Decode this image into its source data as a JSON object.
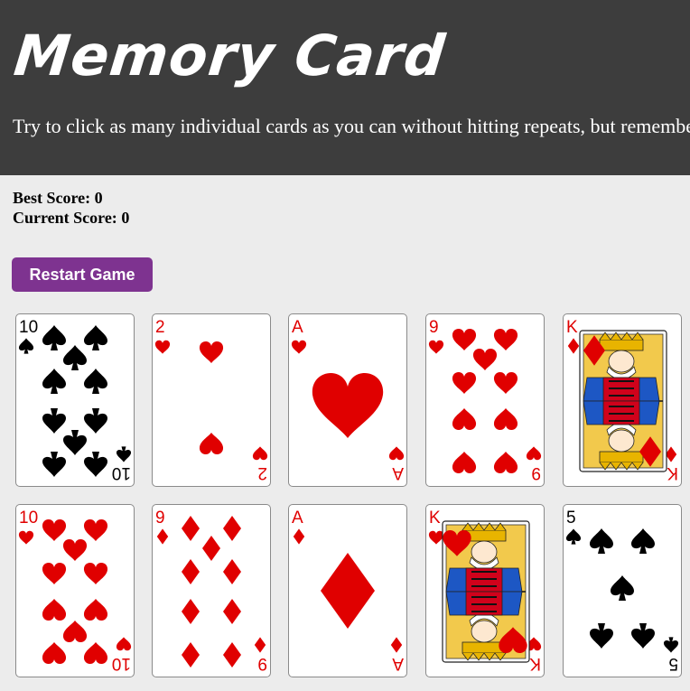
{
  "header": {
    "title": "Memory Card",
    "subtitle": "Try to click as many individual cards as you can without hitting repeats, but remember they shuffle!"
  },
  "scores": {
    "best_label": "Best Score:",
    "best_value": "0",
    "current_label": "Current Score:",
    "current_value": "0"
  },
  "controls": {
    "restart_label": "Restart Game"
  },
  "colors": {
    "header_bg": "#3d3d3d",
    "button_bg": "#7e3390",
    "red_suit": "#e00000",
    "black_suit": "#000000"
  },
  "cards": [
    {
      "rank": "10",
      "suit": "spades"
    },
    {
      "rank": "2",
      "suit": "hearts"
    },
    {
      "rank": "A",
      "suit": "hearts"
    },
    {
      "rank": "9",
      "suit": "hearts"
    },
    {
      "rank": "K",
      "suit": "diamonds"
    },
    {
      "rank": "10",
      "suit": "hearts"
    },
    {
      "rank": "9",
      "suit": "diamonds"
    },
    {
      "rank": "A",
      "suit": "diamonds"
    },
    {
      "rank": "K",
      "suit": "hearts"
    },
    {
      "rank": "5",
      "suit": "spades"
    }
  ]
}
